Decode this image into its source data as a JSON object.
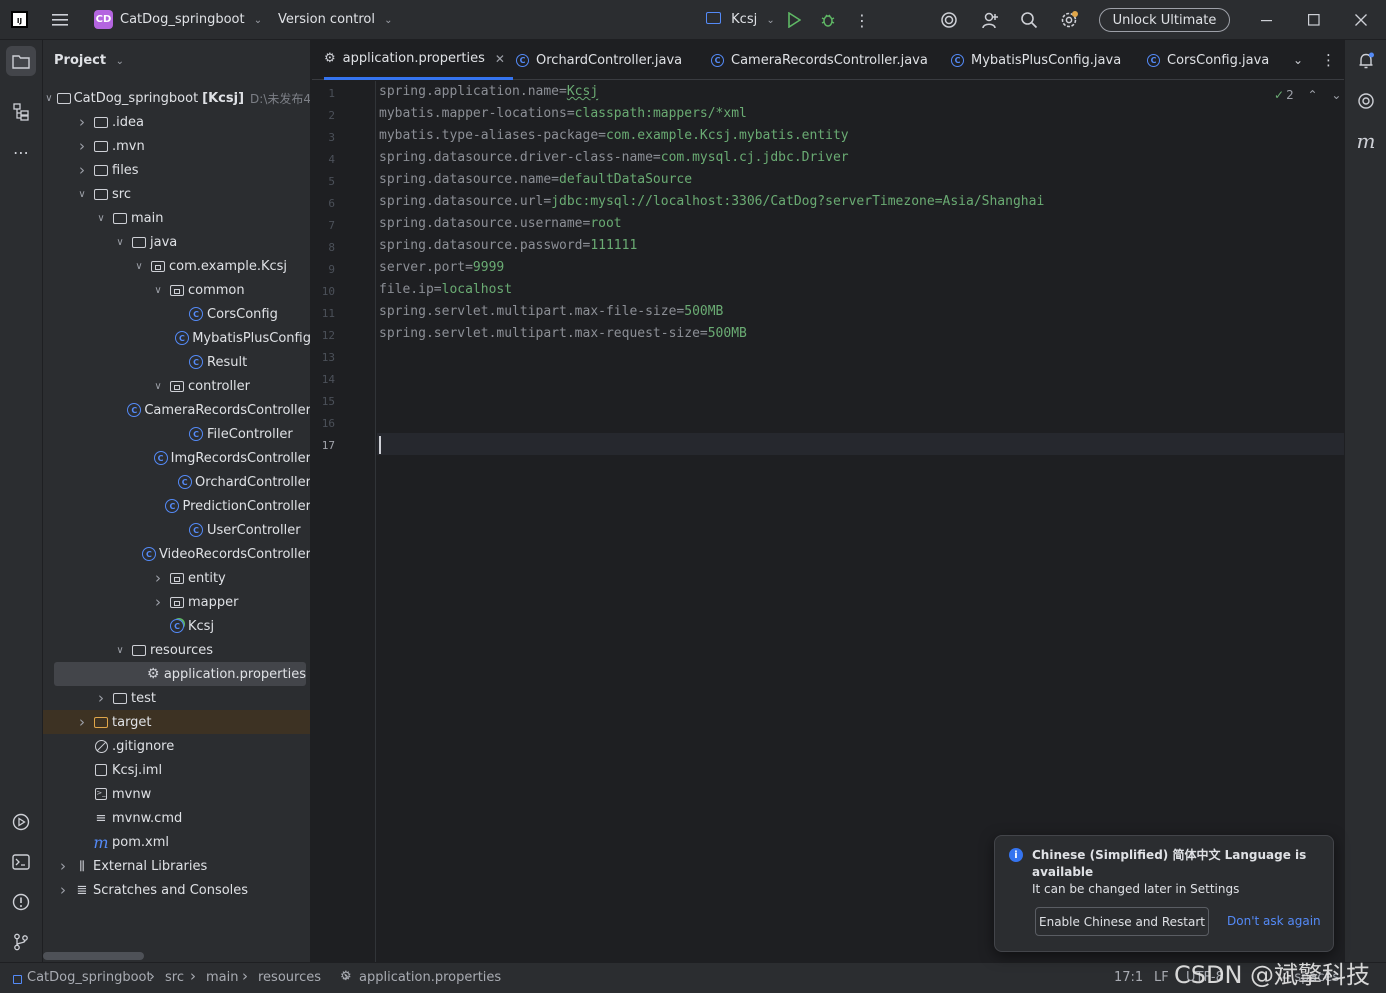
{
  "titlebar": {
    "logo": "IJ",
    "menu_icon": "hamburger-icon",
    "project_badge": "CD",
    "project_name": "CatDog_springboot",
    "vcs": "Version control",
    "run_config": "Kcsj",
    "unlock": "Unlock Ultimate"
  },
  "project_panel": {
    "title": "Project",
    "rows": [
      {
        "label": "CatDog_springboot",
        "bold_suffix": "[Kcsj]",
        "hint": "D:\\未发布4",
        "indent": 0,
        "arrow": "open",
        "icon": "folder"
      },
      {
        "label": ".idea",
        "indent": 1,
        "arrow": "closed",
        "icon": "folder"
      },
      {
        "label": ".mvn",
        "indent": 1,
        "arrow": "closed",
        "icon": "folder"
      },
      {
        "label": "files",
        "indent": 1,
        "arrow": "closed",
        "icon": "folder"
      },
      {
        "label": "src",
        "indent": 1,
        "arrow": "open",
        "icon": "folder"
      },
      {
        "label": "main",
        "indent": 2,
        "arrow": "open",
        "icon": "folder"
      },
      {
        "label": "java",
        "indent": 3,
        "arrow": "open",
        "icon": "folder"
      },
      {
        "label": "com.example.Kcsj",
        "indent": 4,
        "arrow": "open",
        "icon": "package"
      },
      {
        "label": "common",
        "indent": 5,
        "arrow": "open",
        "icon": "package"
      },
      {
        "label": "CorsConfig",
        "indent": 6,
        "arrow": "none",
        "icon": "class"
      },
      {
        "label": "MybatisPlusConfig",
        "indent": 6,
        "arrow": "none",
        "icon": "class"
      },
      {
        "label": "Result",
        "indent": 6,
        "arrow": "none",
        "icon": "class"
      },
      {
        "label": "controller",
        "indent": 5,
        "arrow": "open",
        "icon": "package"
      },
      {
        "label": "CameraRecordsController",
        "indent": 6,
        "arrow": "none",
        "icon": "class"
      },
      {
        "label": "FileController",
        "indent": 6,
        "arrow": "none",
        "icon": "class"
      },
      {
        "label": "ImgRecordsController",
        "indent": 6,
        "arrow": "none",
        "icon": "class"
      },
      {
        "label": "OrchardController",
        "indent": 6,
        "arrow": "none",
        "icon": "class"
      },
      {
        "label": "PredictionController",
        "indent": 6,
        "arrow": "none",
        "icon": "class"
      },
      {
        "label": "UserController",
        "indent": 6,
        "arrow": "none",
        "icon": "class"
      },
      {
        "label": "VideoRecordsController",
        "indent": 6,
        "arrow": "none",
        "icon": "class"
      },
      {
        "label": "entity",
        "indent": 5,
        "arrow": "closed",
        "icon": "package"
      },
      {
        "label": "mapper",
        "indent": 5,
        "arrow": "closed",
        "icon": "package"
      },
      {
        "label": "Kcsj",
        "indent": 5,
        "arrow": "none",
        "icon": "springclass"
      },
      {
        "label": "resources",
        "indent": 3,
        "arrow": "open",
        "icon": "folder"
      },
      {
        "label": "application.properties",
        "indent": 4,
        "arrow": "none",
        "icon": "gear",
        "selected": true
      },
      {
        "label": "test",
        "indent": 2,
        "arrow": "closed",
        "icon": "folder"
      },
      {
        "label": "target",
        "indent": 1,
        "arrow": "closed",
        "icon": "folder-orange",
        "highlight": true
      },
      {
        "label": ".gitignore",
        "indent": 1,
        "arrow": "none",
        "icon": "ignore"
      },
      {
        "label": "Kcsj.iml",
        "indent": 1,
        "arrow": "none",
        "icon": "file"
      },
      {
        "label": "mvnw",
        "indent": 1,
        "arrow": "none",
        "icon": "terminal"
      },
      {
        "label": "mvnw.cmd",
        "indent": 1,
        "arrow": "none",
        "icon": "lines"
      },
      {
        "label": "pom.xml",
        "indent": 1,
        "arrow": "none",
        "icon": "maven"
      },
      {
        "label": "External Libraries",
        "indent": 0,
        "arrow": "closed",
        "icon": "library"
      },
      {
        "label": "Scratches and Consoles",
        "indent": 0,
        "arrow": "closed",
        "icon": "scratch"
      }
    ]
  },
  "tabs": [
    {
      "label": "application.properties",
      "icon": "gear",
      "active": true,
      "closable": true
    },
    {
      "label": "OrchardController.java",
      "icon": "class"
    },
    {
      "label": "CameraRecordsController.java",
      "icon": "class"
    },
    {
      "label": "MybatisPlusConfig.java",
      "icon": "class"
    },
    {
      "label": "CorsConfig.java",
      "icon": "class"
    }
  ],
  "editor": {
    "inspection_count": "2",
    "current_line": 17,
    "lines": [
      {
        "n": "1",
        "key": "spring.application.name=",
        "val": "Kcsj",
        "squiggle": true
      },
      {
        "n": "2",
        "key": "mybatis.mapper-locations=",
        "val": "classpath:mappers/*xml"
      },
      {
        "n": "3",
        "key": "mybatis.type-aliases-package=",
        "val": "com.example.Kcsj.mybatis.entity"
      },
      {
        "n": "4",
        "key": "spring.datasource.driver-class-name=",
        "val": "com.mysql.cj.jdbc.Driver"
      },
      {
        "n": "5",
        "key": "spring.datasource.name=",
        "val": "defaultDataSource"
      },
      {
        "n": "6",
        "key": "spring.datasource.url=",
        "val": "jdbc:mysql://localhost:3306/CatDog?serverTimezone=Asia/Shanghai"
      },
      {
        "n": "7",
        "key": "spring.datasource.username=",
        "val": "root"
      },
      {
        "n": "8",
        "key": "spring.datasource.password=",
        "val": "111111"
      },
      {
        "n": "9",
        "key": "server.port=",
        "val": "9999"
      },
      {
        "n": "10",
        "key": "file.ip=",
        "val": "localhost"
      },
      {
        "n": "11",
        "key": "spring.servlet.multipart.max-file-size=",
        "val": "500MB"
      },
      {
        "n": "12",
        "key": "spring.servlet.multipart.max-request-size=",
        "val": "500MB"
      },
      {
        "n": "13",
        "key": "",
        "val": ""
      },
      {
        "n": "14",
        "key": "",
        "val": ""
      },
      {
        "n": "15",
        "key": "",
        "val": ""
      },
      {
        "n": "16",
        "key": "",
        "val": ""
      },
      {
        "n": "17",
        "key": "",
        "val": ""
      }
    ]
  },
  "notification": {
    "title": "Chinese (Simplified) 简体中文 Language is available",
    "body": "It can be changed later in Settings",
    "primary_button": "Enable Chinese and Restart",
    "link": "Don't ask again"
  },
  "statusbar": {
    "breadcrumbs": [
      "CatDog_springboot",
      "src",
      "main",
      "resources",
      "application.properties"
    ],
    "position": "17:1",
    "line_sep": "LF",
    "encoding": "UTF-8",
    "indent": "4 spaces"
  },
  "watermark": "CSDN @斌擎科技",
  "colors": {
    "accent": "#3574f0",
    "key": "#8c8f96",
    "value": "#6aab73",
    "class_icon": "#548af7",
    "target_folder": "#e0a64a"
  }
}
